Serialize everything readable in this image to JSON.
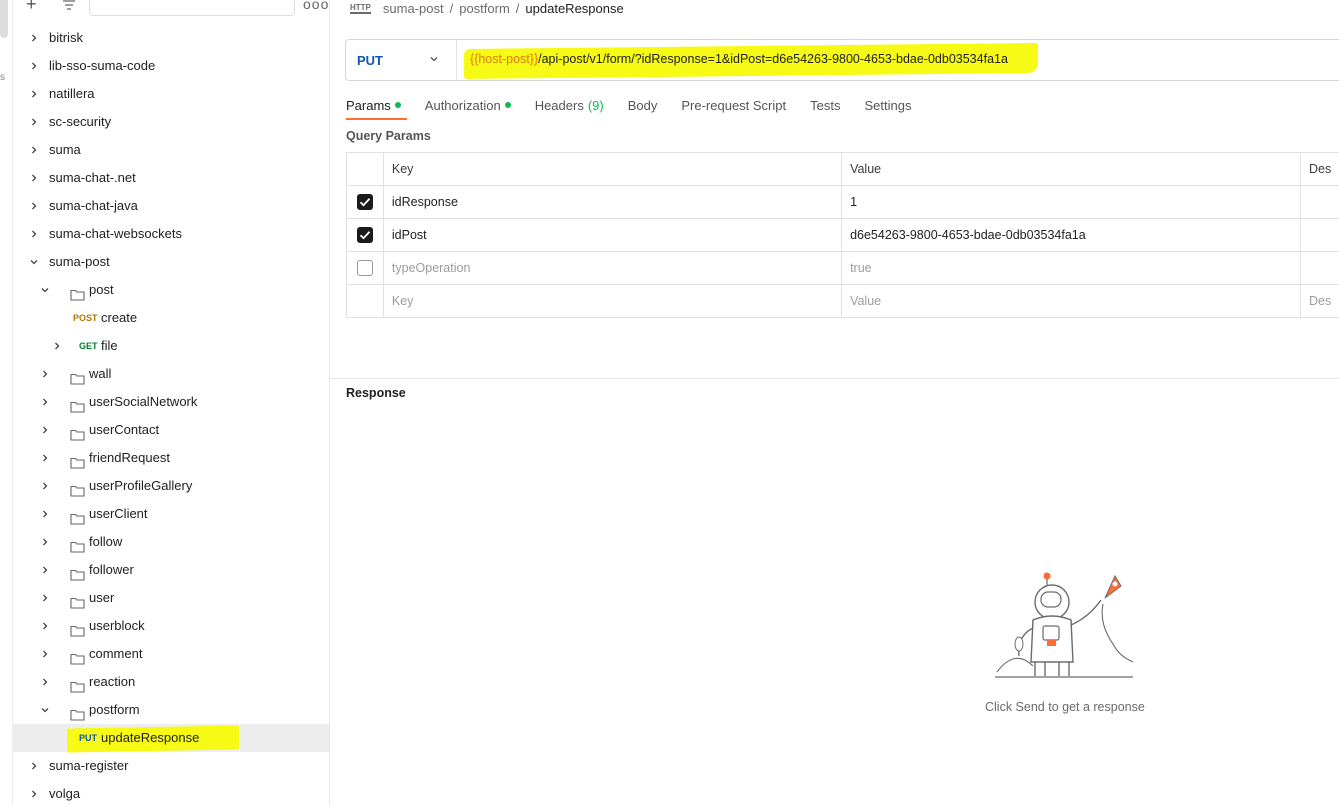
{
  "sidebar": {
    "items": [
      {
        "label": "bitrisk",
        "type": "collection",
        "depth": 0,
        "expanded": false
      },
      {
        "label": "lib-sso-suma-code",
        "type": "collection",
        "depth": 0,
        "expanded": false
      },
      {
        "label": "natillera",
        "type": "collection",
        "depth": 0,
        "expanded": false
      },
      {
        "label": "sc-security",
        "type": "collection",
        "depth": 0,
        "expanded": false
      },
      {
        "label": "suma",
        "type": "collection",
        "depth": 0,
        "expanded": false
      },
      {
        "label": "suma-chat-.net",
        "type": "collection",
        "depth": 0,
        "expanded": false
      },
      {
        "label": "suma-chat-java",
        "type": "collection",
        "depth": 0,
        "expanded": false
      },
      {
        "label": "suma-chat-websockets",
        "type": "collection",
        "depth": 0,
        "expanded": false
      },
      {
        "label": "suma-post",
        "type": "collection",
        "depth": 0,
        "expanded": true
      },
      {
        "label": "post",
        "type": "folder",
        "depth": 1,
        "expanded": true
      },
      {
        "label": "create",
        "type": "request",
        "method": "POST",
        "depth": 2
      },
      {
        "label": "file",
        "type": "request",
        "method": "GET",
        "depth": 2,
        "chevron": true
      },
      {
        "label": "wall",
        "type": "folder",
        "depth": 1,
        "expanded": false
      },
      {
        "label": "userSocialNetwork",
        "type": "folder",
        "depth": 1,
        "expanded": false
      },
      {
        "label": "userContact",
        "type": "folder",
        "depth": 1,
        "expanded": false
      },
      {
        "label": "friendRequest",
        "type": "folder",
        "depth": 1,
        "expanded": false
      },
      {
        "label": "userProfileGallery",
        "type": "folder",
        "depth": 1,
        "expanded": false
      },
      {
        "label": "userClient",
        "type": "folder",
        "depth": 1,
        "expanded": false
      },
      {
        "label": "follow",
        "type": "folder",
        "depth": 1,
        "expanded": false
      },
      {
        "label": "follower",
        "type": "folder",
        "depth": 1,
        "expanded": false
      },
      {
        "label": "user",
        "type": "folder",
        "depth": 1,
        "expanded": false
      },
      {
        "label": "userblock",
        "type": "folder",
        "depth": 1,
        "expanded": false
      },
      {
        "label": "comment",
        "type": "folder",
        "depth": 1,
        "expanded": false
      },
      {
        "label": "reaction",
        "type": "folder",
        "depth": 1,
        "expanded": false
      },
      {
        "label": "postform",
        "type": "folder",
        "depth": 1,
        "expanded": true
      },
      {
        "label": "updateResponse",
        "type": "request",
        "method": "PUT",
        "depth": 2,
        "selected": true
      },
      {
        "label": "suma-register",
        "type": "collection",
        "depth": 0,
        "expanded": false
      },
      {
        "label": "volga",
        "type": "collection",
        "depth": 0,
        "expanded": false
      }
    ]
  },
  "breadcrumb": {
    "icon_text": "HTTP",
    "parts": [
      "suma-post",
      "postform"
    ],
    "separator": "/",
    "current": "updateResponse"
  },
  "request": {
    "method": "PUT",
    "url_variable": "{{host-post}}",
    "url_path": "/api-post/v1/form/?idResponse=1&idPost=d6e54263-9800-4653-bdae-0db03534fa1a"
  },
  "tabs": [
    {
      "label": "Params",
      "active": true,
      "dot": true
    },
    {
      "label": "Authorization",
      "active": false,
      "dot": true
    },
    {
      "label": "Headers",
      "active": false,
      "count": "(9)"
    },
    {
      "label": "Body",
      "active": false
    },
    {
      "label": "Pre-request Script",
      "active": false
    },
    {
      "label": "Tests",
      "active": false
    },
    {
      "label": "Settings",
      "active": false
    }
  ],
  "query_params": {
    "title": "Query Params",
    "headers": {
      "key": "Key",
      "value": "Value",
      "description": "Des"
    },
    "rows": [
      {
        "key": "idResponse",
        "value": "1",
        "checked": true
      },
      {
        "key": "idPost",
        "value": "d6e54263-9800-4653-bdae-0db03534fa1a",
        "checked": true
      },
      {
        "key": "typeOperation",
        "value": "true",
        "checked": false
      }
    ],
    "empty_row": {
      "key": "Key",
      "value": "Value",
      "description": "Des"
    }
  },
  "response": {
    "title": "Response",
    "empty_message": "Click Send to get a response"
  },
  "colors": {
    "accent_tab": "#ff6c37",
    "put": "#0e58b0",
    "post": "#ad7a03",
    "get": "#007f31",
    "status_dot": "#0cbb52",
    "highlight": "#f7fa14",
    "variable": "#e07a14"
  }
}
